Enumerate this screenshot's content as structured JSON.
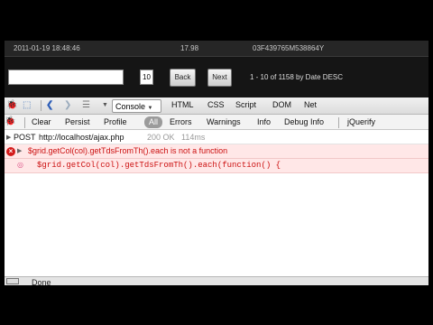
{
  "grid_row": {
    "date": "2011-01-19 18:48:46",
    "amount": "17.98",
    "id": "03F439765M538864Y"
  },
  "pager": {
    "search_value": "",
    "page_size": "10",
    "back_label": "Back",
    "next_label": "Next",
    "info": "1 - 10 of 1158 by Date DESC"
  },
  "firebug": {
    "tabs": [
      "Console",
      "HTML",
      "CSS",
      "Script",
      "DOM",
      "Net"
    ],
    "console_label": "Console",
    "html_label": "HTML",
    "css_label": "CSS",
    "script_label": "Script",
    "dom_label": "DOM",
    "net_label": "Net",
    "sub": {
      "clear": "Clear",
      "persist": "Persist",
      "profile": "Profile",
      "all": "All",
      "errors": "Errors",
      "warnings": "Warnings",
      "info": "Info",
      "debug_info": "Debug Info",
      "jquerify": "jQuerify"
    }
  },
  "console": {
    "post_method": "POST",
    "post_url": "http://localhost/ajax.php",
    "post_status": "200 OK",
    "post_time": "114ms",
    "error_message": "$grid.getCol(col).getTdsFromTh().each is not a function",
    "error_source": "$grid.getCol(col).getTdsFromTh().each(function() {"
  },
  "statusbar": {
    "text": "Done"
  },
  "colors": {
    "error_text": "#cc1111",
    "error_bg": "#ffe7e7",
    "app_bg": "#141414"
  }
}
